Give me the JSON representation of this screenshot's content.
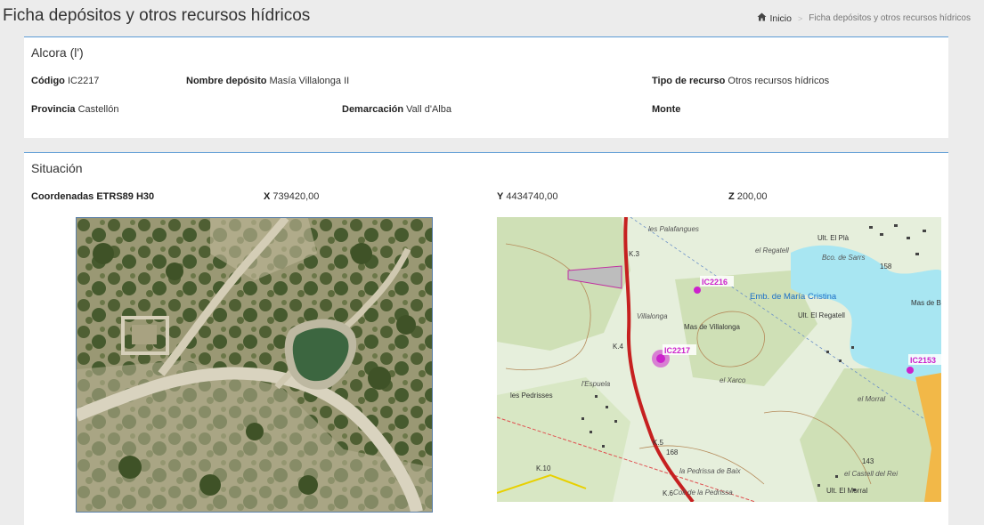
{
  "header": {
    "title": "Ficha depósitos y otros recursos hídricos",
    "breadcrumb": {
      "home": "Inicio",
      "current": "Ficha depósitos y otros recursos hídricos"
    }
  },
  "deposit": {
    "heading": "Alcora (l')",
    "codigo": {
      "label": "Código",
      "value": "IC2217"
    },
    "nombre": {
      "label": "Nombre depósito",
      "value": "Masía Villalonga II"
    },
    "tipo": {
      "label": "Tipo de recurso",
      "value": "Otros recursos hídricos"
    },
    "provincia": {
      "label": "Provincia",
      "value": "Castellón"
    },
    "demarcacion": {
      "label": "Demarcación",
      "value": "Vall d'Alba"
    },
    "monte": {
      "label": "Monte",
      "value": ""
    }
  },
  "situacion": {
    "heading": "Situación",
    "coords_label": "Coordenadas ETRS89 H30",
    "x": {
      "label": "X",
      "value": "739420,00"
    },
    "y": {
      "label": "Y",
      "value": "4434740,00"
    },
    "z": {
      "label": "Z",
      "value": "200,00"
    }
  },
  "topo_map": {
    "markers": [
      {
        "id": "IC2216"
      },
      {
        "id": "IC2217"
      },
      {
        "id": "IC2153"
      }
    ],
    "place_labels": [
      "Emb. de María Cristina",
      "les Palafangues",
      "el Regatell",
      "Villalonga",
      "Mas de Villalonga",
      "el Xarco",
      "les Pedrisses",
      "l'Espuela",
      "Ult. El Regatell",
      "Ult. El Plà",
      "Mas de Brig",
      "el Morral",
      "la Pedrissa de Baix",
      "Coll de la Pedrissa",
      "el Castell del Rei",
      "Ult. El Morral",
      "Bco. de Sarrs",
      "158",
      "168",
      "143",
      "K.3",
      "K.4",
      "K.5",
      "K.6",
      "K.10"
    ]
  },
  "icons": {
    "home": "home-icon",
    "breadcrumb_separator": "chevron-right-icon"
  },
  "colors": {
    "panel_border": "#5b9bd5",
    "marker": "#cc22cc",
    "road": "#c62020",
    "water": "#a8e6f2"
  }
}
